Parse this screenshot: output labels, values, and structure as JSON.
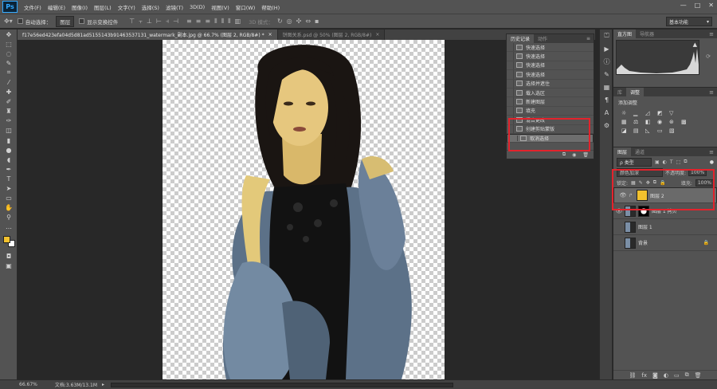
{
  "app": {
    "logo": "Ps"
  },
  "menus": [
    "文件(F)",
    "编辑(E)",
    "图像(I)",
    "图层(L)",
    "文字(Y)",
    "选择(S)",
    "滤镜(T)",
    "3D(D)",
    "视图(V)",
    "窗口(W)",
    "帮助(H)"
  ],
  "window_controls": [
    "—",
    "□",
    "✕"
  ],
  "options": {
    "auto_select_label": "自动选择：",
    "auto_select_value": "图层",
    "show_transform_label": "显示变换控件",
    "mode_3d_label": "3D 模式：",
    "workspace": "基本功能"
  },
  "doc_tabs": [
    {
      "label": "f17e56ed423efa04d5d81ad5155143b91463537131_watermark_副本.jpg @ 66.7% (图层 2, RGB/8#) *",
      "active": true
    },
    {
      "label": "饼图关系.psd @ 50% (图层 2, RGB/8#)",
      "active": false
    }
  ],
  "status": {
    "zoom": "66.67%",
    "doc_info": "文档:3.63M/13.1M"
  },
  "history_panel": {
    "tabs": [
      "历史记录",
      "动作"
    ],
    "items": [
      {
        "label": "快速选择",
        "icon": "quick-select-icon"
      },
      {
        "label": "快速选择",
        "icon": "quick-select-icon"
      },
      {
        "label": "快速选择",
        "icon": "quick-select-icon"
      },
      {
        "label": "快速选择",
        "icon": "quick-select-icon"
      },
      {
        "label": "选择并遮住",
        "icon": "history-step-icon"
      },
      {
        "label": "载入选区",
        "icon": "history-step-icon"
      },
      {
        "label": "新建图层",
        "icon": "history-step-icon"
      },
      {
        "label": "填充",
        "icon": "history-step-icon"
      },
      {
        "label": "混合更改",
        "icon": "history-step-icon"
      },
      {
        "label": "创建剪贴蒙版",
        "icon": "history-step-icon"
      },
      {
        "label": "取消选择",
        "icon": "history-step-icon"
      }
    ]
  },
  "histogram_panel": {
    "tabs": [
      "直方图",
      "导航器"
    ]
  },
  "adjust_panel": {
    "tabs": [
      "库",
      "调整"
    ],
    "title": "添加调整"
  },
  "layers_panel": {
    "tabs": [
      "图层",
      "通道"
    ],
    "filter_label": "ρ 类型",
    "blend_mode": "颜色加深",
    "opacity_label": "不透明度:",
    "opacity_value": "100%",
    "lock_label": "锁定:",
    "fill_label": "填充:",
    "fill_value": "100%",
    "layers": [
      {
        "name": "图层 2",
        "visible": true,
        "selected": true
      },
      {
        "name": "图层 1 拷贝",
        "visible": true,
        "selected": false
      },
      {
        "name": "图层 1",
        "visible": false,
        "selected": false
      },
      {
        "name": "背景",
        "visible": false,
        "selected": false
      }
    ]
  },
  "colors": {
    "highlight_red": "#e3232c",
    "fg_swatch": "#f2c12e",
    "bg_swatch": "#ffffff"
  }
}
